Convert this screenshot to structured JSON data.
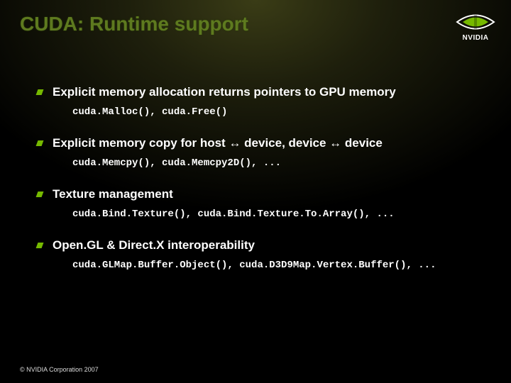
{
  "title": "CUDA: Runtime support",
  "logo": {
    "brand": "NVIDIA"
  },
  "items": [
    {
      "heading": "Explicit memory allocation returns pointers to GPU memory",
      "code": "cuda.Malloc(), cuda.Free()"
    },
    {
      "heading": "Explicit memory copy for host ↔ device, device ↔ device",
      "code": "cuda.Memcpy(), cuda.Memcpy2D(), ..."
    },
    {
      "heading": "Texture management",
      "code": "cuda.Bind.Texture(), cuda.Bind.Texture.To.Array(), ..."
    },
    {
      "heading": "Open.GL & Direct.X interoperability",
      "code": "cuda.GLMap.Buffer.Object(), cuda.D3D9Map.Vertex.Buffer(), ..."
    }
  ],
  "footer": "© NVIDIA Corporation 2007"
}
